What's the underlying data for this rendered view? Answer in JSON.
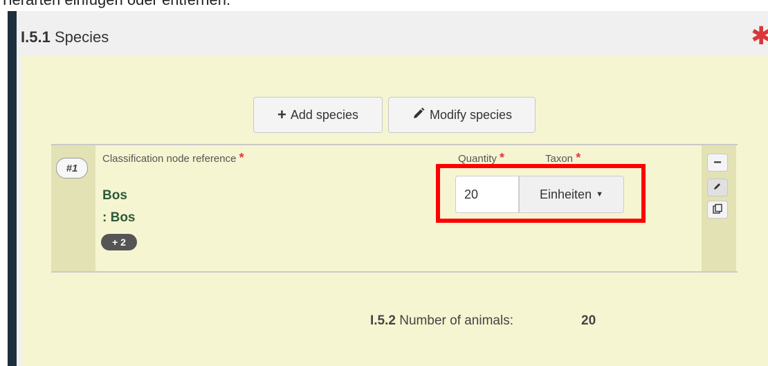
{
  "top_text": "Tierarten einfügen oder entfernen.",
  "section": {
    "code": "I.5.1",
    "title": "Species",
    "required_mark": "✱"
  },
  "buttons": {
    "add_species": "Add species",
    "modify_species": "Modify species"
  },
  "species_entry": {
    "index": "#1",
    "classification_label": "Classification node reference",
    "names": [
      "Bos",
      ": Bos"
    ],
    "more_badge": "+ 2",
    "quantity_label": "Quantity",
    "taxon_label": "Taxon",
    "quantity_value": "20",
    "unit_select": "Einheiten",
    "required_star": "*"
  },
  "actions": {
    "remove_icon": "minus-icon",
    "edit_icon": "pencil-icon",
    "copy_icon": "copy-icon"
  },
  "number_of_animals": {
    "code": "I.5.2",
    "label": "Number of animals:",
    "value": "20"
  },
  "colors": {
    "accent_red": "#d9383a",
    "content_bg": "#f6f5d1",
    "highlight": "#ff0000"
  }
}
